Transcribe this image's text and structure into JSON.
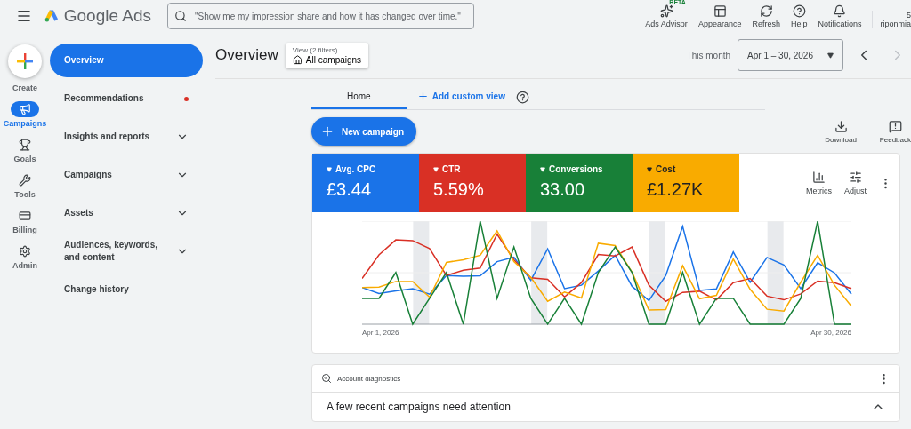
{
  "header": {
    "product": "Google Ads",
    "search_placeholder": "\"Show me my impression share and how it has changed over time.\"",
    "actions": [
      {
        "label": "Ads Advisor",
        "badge": "BETA"
      },
      {
        "label": "Appearance"
      },
      {
        "label": "Refresh"
      },
      {
        "label": "Help"
      },
      {
        "label": "Notifications"
      }
    ],
    "account": {
      "line_1": "5",
      "line_2": "riponmia"
    }
  },
  "rail": [
    {
      "label": "Create",
      "kind": "create",
      "selected": false
    },
    {
      "label": "Campaigns",
      "kind": "item",
      "selected": true
    },
    {
      "label": "Goals",
      "kind": "item",
      "selected": false
    },
    {
      "label": "Tools",
      "kind": "item",
      "selected": false
    },
    {
      "label": "Billing",
      "kind": "item",
      "selected": false
    },
    {
      "label": "Admin",
      "kind": "item",
      "selected": false
    }
  ],
  "nav": [
    {
      "label": "Overview",
      "selected": true,
      "expandable": false,
      "alert": false
    },
    {
      "label": "Recommendations",
      "selected": false,
      "expandable": false,
      "alert": true
    },
    {
      "label": "Insights and reports",
      "selected": false,
      "expandable": true,
      "alert": false
    },
    {
      "label": "Campaigns",
      "selected": false,
      "expandable": true,
      "alert": false
    },
    {
      "label": "Assets",
      "selected": false,
      "expandable": true,
      "alert": false
    },
    {
      "label": "Audiences, keywords, and content",
      "selected": false,
      "expandable": true,
      "alert": false
    },
    {
      "label": "Change history",
      "selected": false,
      "expandable": false,
      "alert": false
    }
  ],
  "page": {
    "title": "Overview",
    "view": {
      "caption": "View (2 filters)",
      "value": "All campaigns"
    },
    "period_label": "This month",
    "date_range": "Apr 1 – 30, 2026"
  },
  "tabs": [
    {
      "label": "Home",
      "kind": "tab",
      "selected": true
    },
    {
      "label": "Add custom view",
      "kind": "add",
      "selected": false
    }
  ],
  "new_campaign": "New campaign",
  "tools": [
    {
      "label": "Download"
    },
    {
      "label": "Feedback"
    }
  ],
  "metrics": [
    {
      "label": "Avg. CPC",
      "value": "£3.44",
      "color": "#1a73e8"
    },
    {
      "label": "CTR",
      "value": "5.59%",
      "color": "#d93025"
    },
    {
      "label": "Conversions",
      "value": "33.00",
      "color": "#188038"
    },
    {
      "label": "Cost",
      "value": "£1.27K",
      "color": "#f9ab00"
    }
  ],
  "metric_actions": [
    {
      "label": "Metrics"
    },
    {
      "label": "Adjust"
    }
  ],
  "chart": {
    "x_start": "Apr 1, 2026",
    "x_end": "Apr 30, 2026"
  },
  "diagnostics": {
    "title": "Account diagnostics",
    "heading": "A few recent campaigns need attention",
    "expanded": true
  }
}
